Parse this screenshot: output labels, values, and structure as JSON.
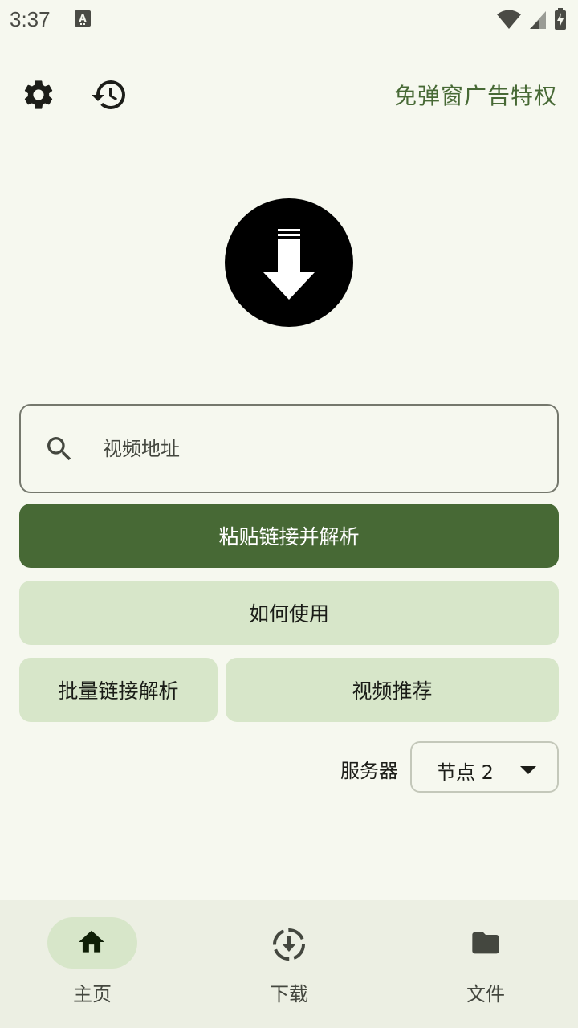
{
  "status_bar": {
    "time": "3:37"
  },
  "header": {
    "privilege_link": "免弹窗广告特权"
  },
  "search": {
    "placeholder": "视频地址"
  },
  "actions": {
    "paste_parse": "粘贴链接并解析",
    "how_to_use": "如何使用",
    "batch_parse": "批量链接解析",
    "video_recommend": "视频推荐"
  },
  "server": {
    "label": "服务器",
    "selected": "节点 2"
  },
  "bottom_nav": {
    "items": [
      {
        "label": "主页",
        "icon": "home-icon",
        "active": true
      },
      {
        "label": "下载",
        "icon": "download-circle-icon",
        "active": false
      },
      {
        "label": "文件",
        "icon": "folder-icon",
        "active": false
      }
    ]
  },
  "colors": {
    "background": "#f6f8ef",
    "primary": "#476935",
    "tonal": "#d7e6c9",
    "nav_background": "#ecefe3"
  }
}
